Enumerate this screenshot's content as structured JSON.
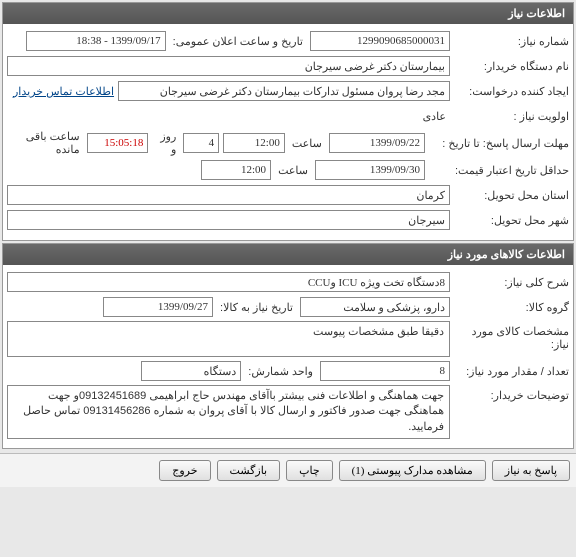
{
  "panel1": {
    "title": "اطلاعات نیاز",
    "rows": {
      "req_no_label": "شماره نیاز:",
      "req_no": "1299090685000031",
      "pub_date_label": "تاریخ و ساعت اعلان عمومی:",
      "pub_date": "1399/09/17 - 18:38",
      "org_label": "نام دستگاه خریدار:",
      "org": "بیمارستان دکتر غرضی سیرجان",
      "creator_label": "ایجاد کننده درخواست:",
      "creator": "مجد رضا پروان مسئول تدارکات بیمارستان دکتر غرضی سیرجان",
      "contact_link": "اطلاعات تماس خریدار",
      "priority_label": "اولویت نیاز :",
      "priority": "عادی",
      "deadline_label": "مهلت ارسال پاسخ:  تا تاریخ :",
      "deadline_date": "1399/09/22",
      "time_label": "ساعت",
      "deadline_time": "12:00",
      "days_left": "4",
      "days_unit": "روز و",
      "countdown": "15:05:18",
      "remain_label": "ساعت باقی مانده",
      "min_valid_label": "حداقل تاریخ اعتبار قیمت:",
      "min_valid_date": "1399/09/30",
      "min_valid_time": "12:00",
      "province_label": "استان محل تحویل:",
      "province": "کرمان",
      "city_label": "شهر محل تحویل:",
      "city": "سیرجان"
    }
  },
  "panel2": {
    "title": "اطلاعات کالاهای مورد نیاز",
    "rows": {
      "desc_label": "شرح کلی نیاز:",
      "desc": "8دستگاه تخت ویژه ICU وCCU",
      "group_label": "گروه کالا:",
      "group": "دارو، پزشکی و سلامت",
      "need_date_label": "تاریخ نیاز به کالا:",
      "need_date": "1399/09/27",
      "spec_label": "مشخصات کالای مورد نیاز:",
      "spec": "دقیقا طبق مشخصات پیوست",
      "qty_label": "تعداد / مقدار مورد نیاز:",
      "qty": "8",
      "unit_label": "واحد شمارش:",
      "unit": "دستگاه",
      "notes_label": "توضیحات خریدار:",
      "notes": "جهت هماهنگی و اطلاعات فنی بیشتر باآقای مهندس حاج ابراهیمی 09132451689و جهت هماهنگی جهت صدور فاکتور و ارسال کالا با آقای پروان به شماره 09131456286 تماس حاصل فرمایید."
    }
  },
  "buttons": {
    "respond": "پاسخ به نیاز",
    "attachments": "مشاهده مدارک پیوستی  (1)",
    "print": "چاپ",
    "back": "بازگشت",
    "exit": "خروج"
  }
}
